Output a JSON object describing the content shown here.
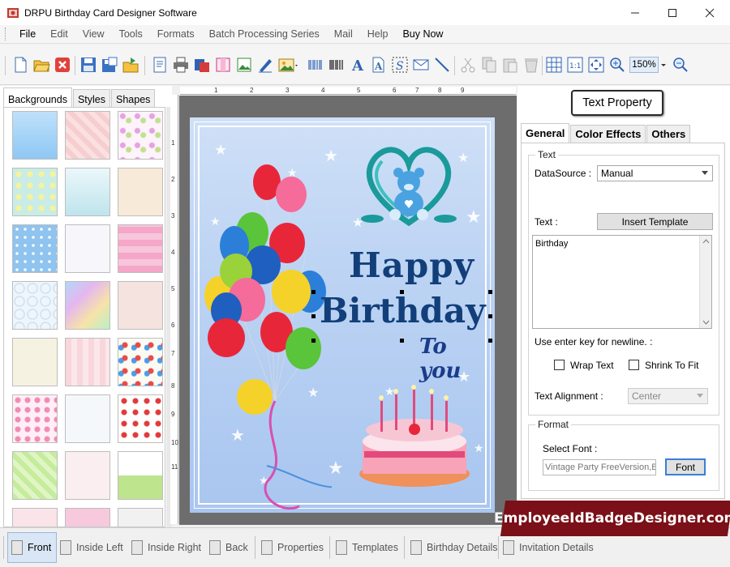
{
  "window": {
    "title": "DRPU Birthday Card Designer Software",
    "controls": [
      "minimize",
      "maximize",
      "close"
    ]
  },
  "menu": [
    "File",
    "Edit",
    "View",
    "Tools",
    "Formats",
    "Batch Processing Series",
    "Mail",
    "Help",
    "Buy Now"
  ],
  "toolbar": {
    "zoom": "150%",
    "icons": [
      "new-icon",
      "open-icon",
      "close-icon",
      "save-icon",
      "save-as-icon",
      "export-icon",
      "properties-icon",
      "print-icon",
      "print-preview-icon",
      "card-icon",
      "image-icon",
      "signature-icon",
      "picture-icon",
      "barcode-icon",
      "barcode2-icon",
      "text-icon",
      "word-art-icon",
      "symbol-icon",
      "mail-icon",
      "line-icon",
      "cut-icon",
      "copy-icon",
      "paste-icon",
      "delete-icon",
      "grid-icon",
      "actual-size-icon",
      "fit-icon",
      "zoom-in-icon",
      "zoom-out-icon"
    ]
  },
  "left_panel": {
    "tabs": [
      "Backgrounds",
      "Styles",
      "Shapes"
    ],
    "active_tab": "Backgrounds"
  },
  "ruler": {
    "top": [
      "1",
      "2",
      "3",
      "4",
      "5",
      "6",
      "7",
      "8",
      "9"
    ],
    "left": [
      "1",
      "2",
      "3",
      "4",
      "5",
      "6",
      "7",
      "8",
      "9",
      "10",
      "11"
    ]
  },
  "card": {
    "line1": "Happy",
    "line2": "Birthday",
    "line3": "To you"
  },
  "right_panel": {
    "header": "Text Property",
    "tabs": [
      "General",
      "Color Effects",
      "Others"
    ],
    "active_tab": "General",
    "text_group": "Text",
    "datasource_label": "DataSource :",
    "datasource_value": "Manual",
    "text_label": "Text :",
    "insert_template": "Insert Template",
    "text_value": "Birthday",
    "newline_hint": "Use enter key for newline. :",
    "wrap_text": "Wrap Text",
    "shrink_to_fit": "Shrink To Fit",
    "alignment_label": "Text Alignment :",
    "alignment_value": "Center",
    "format_group": "Format",
    "select_font_label": "Select Font :",
    "font_value": "Vintage Party FreeVersion,Bo",
    "font_button": "Font"
  },
  "bottom_tabs": [
    "Front",
    "Inside Left",
    "Inside Right",
    "Back",
    "Properties",
    "Templates",
    "Birthday Details",
    "Invitation Details"
  ],
  "active_bottom_tab": "Front",
  "watermark": "EmployeeIdBadgeDesigner.com"
}
